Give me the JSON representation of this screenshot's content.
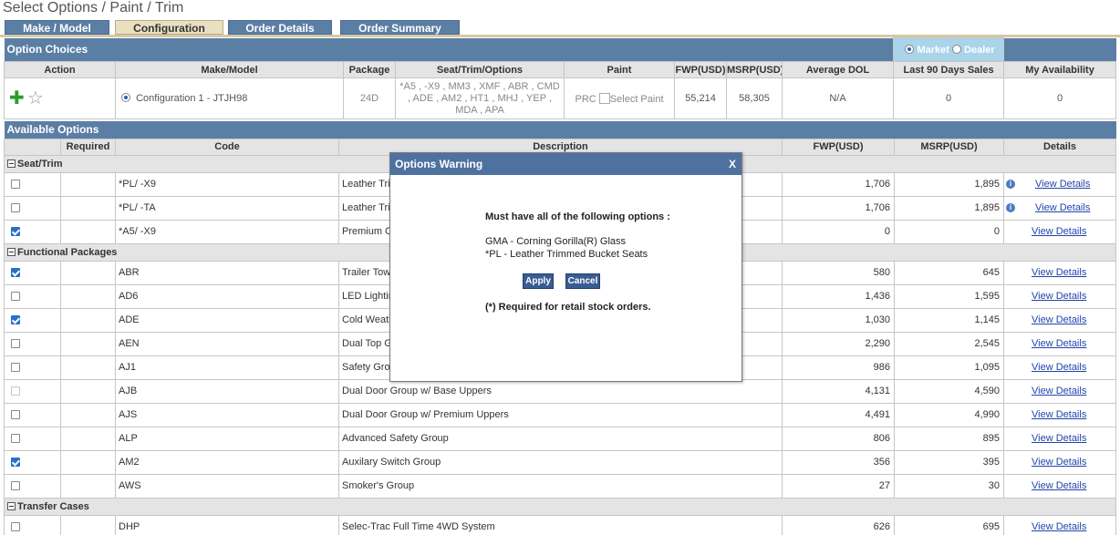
{
  "page_title": "Select Options / Paint / Trim",
  "tabs": [
    {
      "label": "Make / Model"
    },
    {
      "label": "Configuration"
    },
    {
      "label": "Order Details"
    },
    {
      "label": "Order Summary"
    }
  ],
  "option_choices": {
    "title": "Option Choices",
    "market_label": "Market",
    "dealer_label": "Dealer",
    "headers": [
      "Action",
      "Make/Model",
      "Package",
      "Seat/Trim/Options",
      "Paint",
      "FWP(USD)",
      "MSRP(USD)",
      "Average DOL",
      "Last 90 Days Sales",
      "My Availability"
    ],
    "row": {
      "config_label": "Configuration 1  -  JTJH98",
      "package": "24D",
      "seat_trim_options": [
        "*A5 , -X9 , MM3 , XMF , ABR , CMD",
        ", ADE , AM2 , HT1 , MHJ , YEP ,",
        "MDA , APA"
      ],
      "paint_code": "PRC",
      "paint_alt": "Select Paint",
      "fwp": "55,214",
      "msrp": "58,305",
      "avg_dol": "N/A",
      "last90": "0",
      "availability": "0"
    }
  },
  "available_options": {
    "title": "Available Options",
    "headers": [
      "",
      "Required",
      "Code",
      "Description",
      "FWP(USD)",
      "MSRP(USD)",
      "Details"
    ],
    "groups": [
      {
        "name": "Seat/Trim",
        "rows": [
          {
            "checked": false,
            "code": "*PL/ -X9",
            "desc": "Leather Trim",
            "fwp": "1,706",
            "msrp": "1,895",
            "info": true,
            "details": "View Details"
          },
          {
            "checked": false,
            "code": "*PL/ -TA",
            "desc": "Leather Trim",
            "fwp": "1,706",
            "msrp": "1,895",
            "info": true,
            "details": "View Details"
          },
          {
            "checked": true,
            "code": "*A5/ -X9",
            "desc": "Premium Clo",
            "fwp": "0",
            "msrp": "0",
            "info": false,
            "details": "View Details"
          }
        ]
      },
      {
        "name": "Functional Packages",
        "rows": [
          {
            "checked": true,
            "code": "ABR",
            "desc": "Trailer Tow",
            "fwp": "580",
            "msrp": "645",
            "details": "View Details"
          },
          {
            "checked": false,
            "code": "AD6",
            "desc": "LED Lightin",
            "fwp": "1,436",
            "msrp": "1,595",
            "details": "View Details"
          },
          {
            "checked": true,
            "code": "ADE",
            "desc": "Cold Weath",
            "fwp": "1,030",
            "msrp": "1,145",
            "details": "View Details"
          },
          {
            "checked": false,
            "code": "AEN",
            "desc": "Dual Top Gr",
            "fwp": "2,290",
            "msrp": "2,545",
            "details": "View Details"
          },
          {
            "checked": false,
            "code": "AJ1",
            "desc": "Safety Grou",
            "fwp": "986",
            "msrp": "1,095",
            "details": "View Details"
          },
          {
            "checked": false,
            "disabled": true,
            "code": "AJB",
            "desc": "Dual Door Group w/ Base Uppers",
            "fwp": "4,131",
            "msrp": "4,590",
            "details": "View Details"
          },
          {
            "checked": false,
            "code": "AJS",
            "desc": "Dual Door Group w/ Premium Uppers",
            "fwp": "4,491",
            "msrp": "4,990",
            "details": "View Details"
          },
          {
            "checked": false,
            "code": "ALP",
            "desc": "Advanced Safety Group",
            "fwp": "806",
            "msrp": "895",
            "details": "View Details"
          },
          {
            "checked": true,
            "code": "AM2",
            "desc": "Auxilary Switch Group",
            "fwp": "356",
            "msrp": "395",
            "details": "View Details"
          },
          {
            "checked": false,
            "code": "AWS",
            "desc": "Smoker's Group",
            "fwp": "27",
            "msrp": "30",
            "details": "View Details"
          }
        ]
      },
      {
        "name": "Transfer Cases",
        "rows": [
          {
            "checked": false,
            "code": "DHP",
            "desc": "Selec-Trac Full Time 4WD System",
            "fwp": "626",
            "msrp": "695",
            "details": "View Details"
          }
        ]
      }
    ]
  },
  "modal": {
    "title": "Options Warning",
    "close": "X",
    "heading": "Must have all of the following options :",
    "items": [
      "GMA - Corning Gorilla(R) Glass",
      "*PL - Leather Trimmed Bucket Seats"
    ],
    "apply": "Apply",
    "cancel": "Cancel",
    "note": "(*) Required for retail stock orders."
  }
}
